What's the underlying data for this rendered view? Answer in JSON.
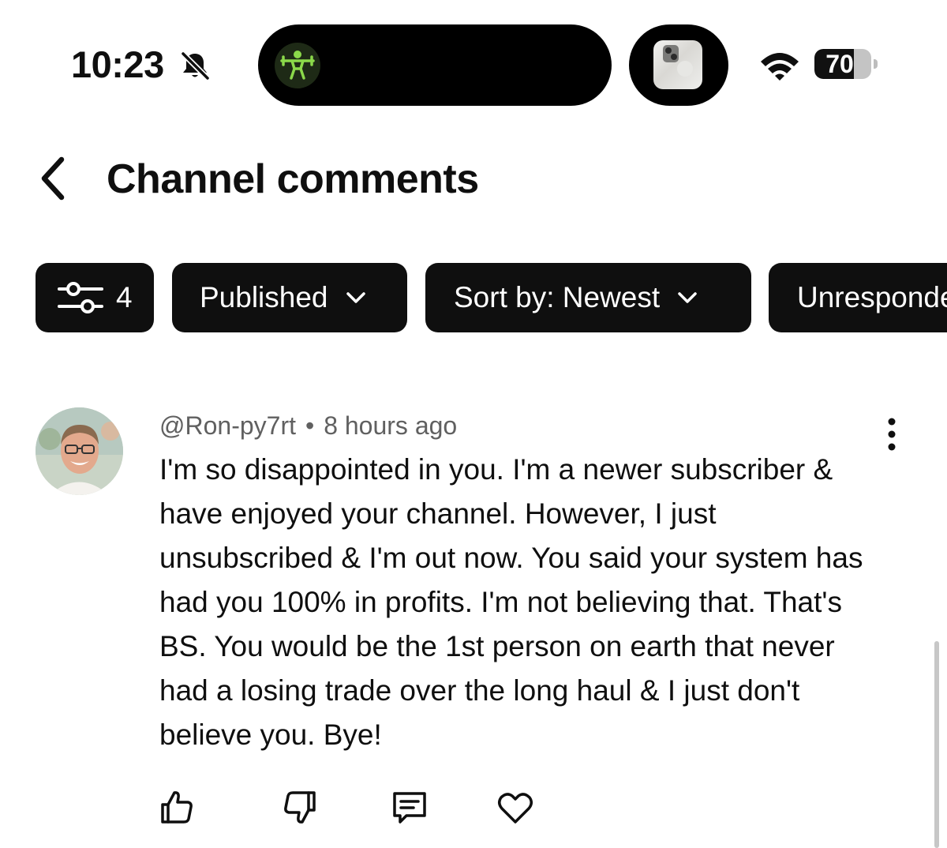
{
  "status_bar": {
    "time": "10:23",
    "battery_level": "70",
    "battery_fraction": 0.7,
    "icons": [
      "bell-slash-icon",
      "fitness-icon",
      "wifi-icon",
      "battery-icon"
    ]
  },
  "header": {
    "title": "Channel comments",
    "back_icon": "chevron-left-icon"
  },
  "chips": {
    "filter_count": "4",
    "published": "Published",
    "sort": "Sort by: Newest",
    "unresponded": "Unresponded"
  },
  "comment": {
    "author": "@Ron-py7rt",
    "separator": "•",
    "time": "8 hours ago",
    "text": "I'm so disappointed in you. I'm a newer subscriber & have enjoyed your channel. However, I just unsubscribed & I'm out now. You said your system has had you 100% in profits. I'm not believing that. That's BS. You would be the 1st person on earth that never had a losing trade over the long haul & I just don't believe you. Bye!"
  },
  "colors": {
    "chip_background": "#0f0f0f",
    "meta_text": "#606060",
    "fitness_accent": "#8bd94a"
  }
}
